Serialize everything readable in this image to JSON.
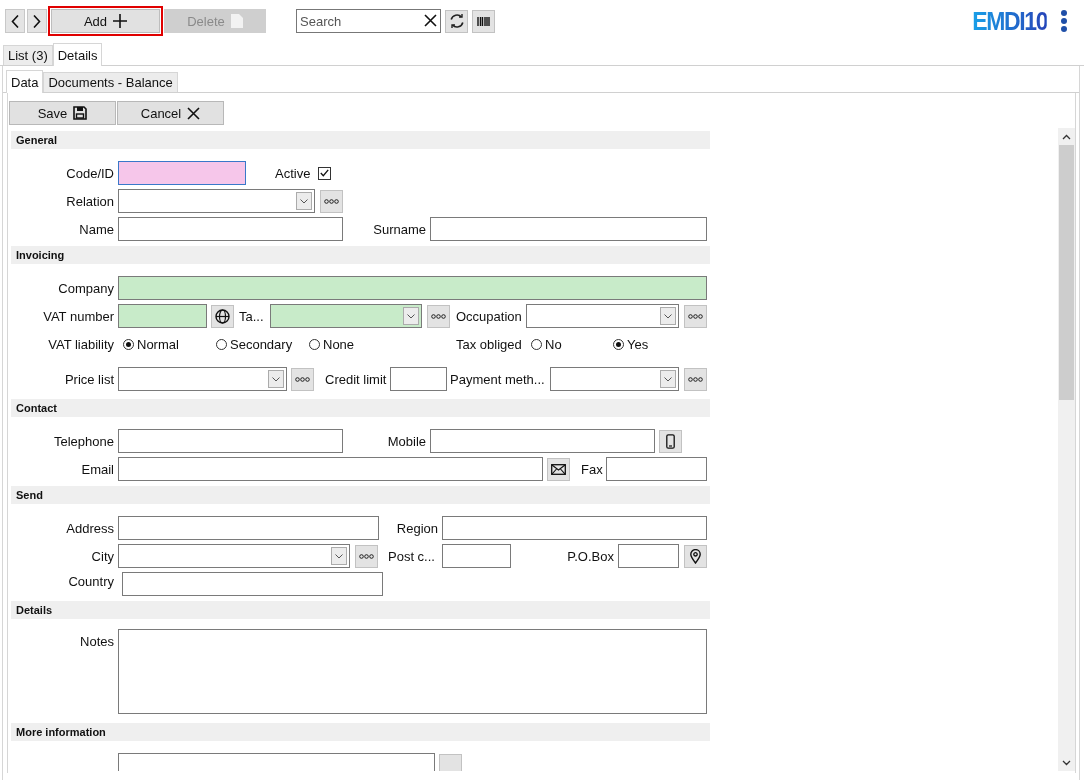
{
  "toolbar": {
    "add": {
      "label": "Add",
      "highlighted": true
    },
    "delete": {
      "label": "Delete",
      "disabled": true
    },
    "search": {
      "placeholder": "Search"
    }
  },
  "logo": "EMDI10",
  "tabs": [
    {
      "label": "List (3)",
      "selected": false
    },
    {
      "label": "Details",
      "selected": true
    }
  ],
  "subtabs": [
    {
      "label": "Data",
      "selected": true
    },
    {
      "label": "Documents - Balance",
      "selected": false
    }
  ],
  "actions": {
    "save": "Save",
    "cancel": "Cancel"
  },
  "general": {
    "title": "General",
    "code": {
      "label": "Code/ID",
      "focused": true
    },
    "active": {
      "label": "Active",
      "checked": true
    },
    "relation": {
      "label": "Relation"
    },
    "name": {
      "label": "Name"
    },
    "surname": {
      "label": "Surname"
    }
  },
  "invoicing": {
    "title": "Invoicing",
    "company": {
      "label": "Company",
      "required": true
    },
    "vat_number": {
      "label": "VAT number",
      "required": true
    },
    "tax_office": {
      "label": "Ta...",
      "required": true
    },
    "occupation": {
      "label": "Occupation",
      "required": false
    },
    "vat_liability": {
      "label": "VAT liability",
      "options": [
        {
          "label": "Normal",
          "selected": true
        },
        {
          "label": "Secondary",
          "selected": false
        },
        {
          "label": "None",
          "selected": false
        }
      ]
    },
    "tax_obliged": {
      "label": "Tax obliged",
      "options": [
        {
          "label": "No",
          "selected": false
        },
        {
          "label": "Yes",
          "selected": true
        }
      ]
    },
    "price_list": {
      "label": "Price list"
    },
    "credit_limit": {
      "label": "Credit limit"
    },
    "payment_method": {
      "label": "Payment meth..."
    }
  },
  "contact": {
    "title": "Contact",
    "telephone": {
      "label": "Telephone"
    },
    "mobile": {
      "label": "Mobile"
    },
    "email": {
      "label": "Email"
    },
    "fax": {
      "label": "Fax"
    }
  },
  "send": {
    "title": "Send",
    "address": {
      "label": "Address"
    },
    "region": {
      "label": "Region"
    },
    "city": {
      "label": "City"
    },
    "post_code": {
      "label": "Post c..."
    },
    "po_box": {
      "label": "P.O.Box"
    },
    "country": {
      "label": "Country"
    }
  },
  "details": {
    "title": "Details",
    "notes": {
      "label": "Notes"
    }
  },
  "more_information": {
    "title": "More information"
  }
}
